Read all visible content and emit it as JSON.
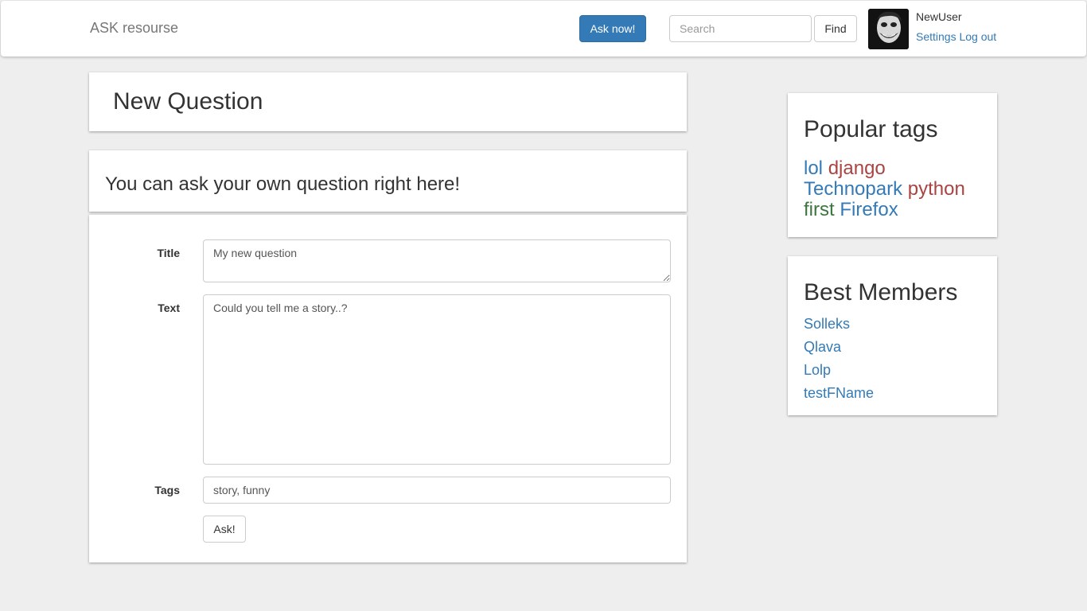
{
  "navbar": {
    "brand": "ASK resourse",
    "ask_button": "Ask now!",
    "search_placeholder": "Search",
    "find_button": "Find",
    "username": "NewUser",
    "settings_link": "Settings",
    "logout_link": "Log out"
  },
  "main": {
    "page_title": "New Question",
    "intro": "You can ask your own question right here!",
    "form": {
      "title_label": "Title",
      "title_value": "My new question",
      "text_label": "Text",
      "text_value": "Could you tell me a story..?",
      "tags_label": "Tags",
      "tags_value": "story, funny",
      "submit_button": "Ask!"
    }
  },
  "sidebar": {
    "popular_tags_heading": "Popular tags",
    "tags": [
      {
        "label": "lol",
        "color": "#337ab7"
      },
      {
        "label": "django",
        "color": "#a94442"
      },
      {
        "label": "Technopark",
        "color": "#337ab7"
      },
      {
        "label": "python",
        "color": "#a94442"
      },
      {
        "label": "first",
        "color": "#3c763d"
      },
      {
        "label": "Firefox",
        "color": "#337ab7"
      }
    ],
    "best_members_heading": "Best Members",
    "members": [
      "Solleks",
      "Qlava",
      "Lolp",
      "testFName"
    ]
  },
  "colors": {
    "primary": "#337ab7",
    "background": "#eeeeee"
  }
}
